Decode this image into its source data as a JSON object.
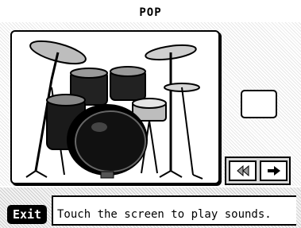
{
  "screen": {
    "title": "POP"
  },
  "drum_image": {
    "icon": "drum-kit-illustration"
  },
  "pad": {
    "icon": "blank-pad"
  },
  "navigation": {
    "prev_icon": "double-left-arrow-icon",
    "next_icon": "right-arrow-icon"
  },
  "footer": {
    "exit_label": "Exit",
    "message": "Touch the screen to play sounds."
  }
}
